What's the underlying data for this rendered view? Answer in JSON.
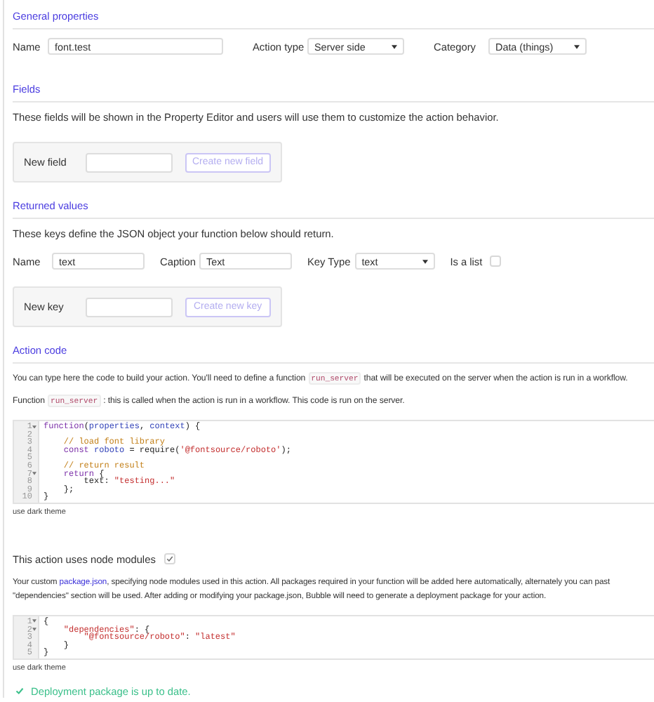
{
  "general": {
    "title": "General properties",
    "name": {
      "label": "Name",
      "value": "font.test"
    },
    "action_type": {
      "label": "Action type",
      "value": "Server side"
    },
    "category": {
      "label": "Category",
      "value": "Data (things)"
    }
  },
  "fields": {
    "title": "Fields",
    "description": "These fields will be shown in the Property Editor and users will use them to customize the action behavior.",
    "new_field": {
      "label": "New field",
      "button": "Create new field"
    }
  },
  "returned_values": {
    "title": "Returned values",
    "description": "These keys define the JSON object your function below should return.",
    "key": {
      "name_label": "Name",
      "name_value": "text",
      "caption_label": "Caption",
      "caption_value": "Text",
      "type_label": "Key Type",
      "type_value": "text",
      "list_label": "Is a list",
      "is_list": false
    },
    "new_key": {
      "label": "New key",
      "button": "Create new key"
    }
  },
  "action_code": {
    "title": "Action code",
    "paragraphs": [
      [
        {
          "kind": "text",
          "text": "You can type here the code to build your action. You'll need to define a function"
        },
        {
          "kind": "code",
          "text": "run_server"
        },
        {
          "kind": "text",
          "text": "that will be executed on the server when the action is run in a workflow."
        }
      ],
      [
        {
          "kind": "text",
          "text": "Function"
        },
        {
          "kind": "code",
          "text": "run_server"
        },
        {
          "kind": "text",
          "text": ": this is called when the action is run in a workflow. This code is run on the server."
        }
      ]
    ],
    "editor": {
      "lines": [
        {
          "number": "1",
          "fold": true,
          "tokens": [
            {
              "kind": "keyword",
              "text": "function"
            },
            {
              "kind": "plain",
              "text": "("
            },
            {
              "kind": "variable",
              "text": "properties"
            },
            {
              "kind": "plain",
              "text": ", "
            },
            {
              "kind": "variable",
              "text": "context"
            },
            {
              "kind": "plain",
              "text": ") {"
            }
          ]
        },
        {
          "number": "2",
          "fold": false
        },
        {
          "number": "3",
          "fold": false,
          "tokens": [
            {
              "kind": "comment",
              "text": "    // load font library"
            }
          ]
        },
        {
          "number": "4",
          "fold": false,
          "tokens": [
            {
              "kind": "keyword",
              "text": "    const "
            },
            {
              "kind": "variable",
              "text": "roboto"
            },
            {
              "kind": "plain",
              "text": " = require("
            },
            {
              "kind": "string",
              "text": "'@fontsource/roboto'"
            },
            {
              "kind": "plain",
              "text": ");"
            }
          ]
        },
        {
          "number": "5",
          "fold": false
        },
        {
          "number": "6",
          "fold": false,
          "tokens": [
            {
              "kind": "comment",
              "text": "    // return result"
            }
          ]
        },
        {
          "number": "7",
          "fold": true,
          "tokens": [
            {
              "kind": "keyword",
              "text": "    return"
            },
            {
              "kind": "plain",
              "text": " {"
            }
          ]
        },
        {
          "number": "8",
          "fold": false,
          "tokens": [
            {
              "kind": "plain",
              "text": "        text: "
            },
            {
              "kind": "string",
              "text": "\"testing...\""
            }
          ]
        },
        {
          "number": "9",
          "fold": false,
          "tokens": [
            {
              "kind": "plain",
              "text": "    };"
            }
          ]
        },
        {
          "number": "10",
          "fold": false,
          "tokens": [
            {
              "kind": "plain",
              "text": "}"
            }
          ]
        }
      ],
      "theme_link": "use dark theme"
    }
  },
  "node_modules": {
    "label": "This action uses node modules",
    "checked": true,
    "paragraph_lines": [
      [
        {
          "kind": "text",
          "text": "Your custom "
        },
        {
          "kind": "link",
          "text": "package.json"
        },
        {
          "kind": "text",
          "text": ", specifying node modules used in this action. All packages required in your function will be added here automatically, alternately you can past"
        }
      ],
      [
        {
          "kind": "text",
          "text": "\"dependencies\" section will be used. After adding or modifying your package.json, Bubble will need to generate a deployment package for your action."
        }
      ]
    ],
    "editor": {
      "lines": [
        {
          "number": "1",
          "fold": true,
          "tokens": [
            {
              "kind": "plain",
              "text": "{"
            }
          ]
        },
        {
          "number": "2",
          "fold": true,
          "tokens": [
            {
              "kind": "string",
              "text": "    \"dependencies\""
            },
            {
              "kind": "plain",
              "text": ": {"
            }
          ]
        },
        {
          "number": "3",
          "fold": false,
          "tokens": [
            {
              "kind": "string",
              "text": "        \"@fontsource/roboto\""
            },
            {
              "kind": "plain",
              "text": ": "
            },
            {
              "kind": "string",
              "text": "\"latest\""
            }
          ]
        },
        {
          "number": "4",
          "fold": false,
          "tokens": [
            {
              "kind": "plain",
              "text": "    }"
            }
          ]
        },
        {
          "number": "5",
          "fold": false,
          "tokens": [
            {
              "kind": "plain",
              "text": "}"
            }
          ]
        }
      ],
      "theme_link": "use dark theme"
    },
    "status": "Deployment package is up to date."
  }
}
